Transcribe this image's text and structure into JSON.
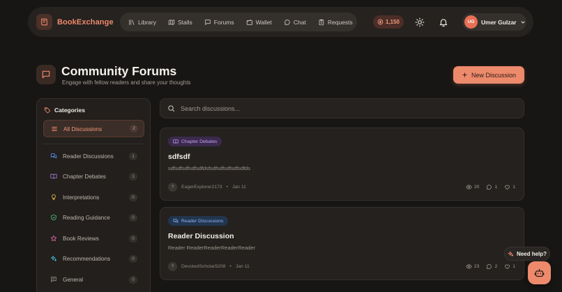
{
  "brand": {
    "name": "BookExchange"
  },
  "nav": {
    "items": [
      {
        "label": "Library",
        "icon": "library-icon"
      },
      {
        "label": "Stalls",
        "icon": "map-icon"
      },
      {
        "label": "Forums",
        "icon": "message-square-icon"
      },
      {
        "label": "Wallet",
        "icon": "wallet-icon"
      },
      {
        "label": "Chat",
        "icon": "chat-bubble-icon"
      },
      {
        "label": "Requests",
        "icon": "clipboard-icon"
      }
    ],
    "coins": "1,150",
    "user": {
      "initials": "UG",
      "name": "Umer Gulzar"
    }
  },
  "header": {
    "title": "Community Forums",
    "subtitle": "Engage with fellow readers and share your thoughts",
    "new_button": "New Discussion"
  },
  "categories": {
    "heading": "Categories",
    "active": {
      "label": "All Discussions",
      "count": "2"
    },
    "items": [
      {
        "label": "Reader Discussions",
        "count": "1",
        "icon": "chat-bubbles-icon",
        "color": "#5b8ee8"
      },
      {
        "label": "Chapter Debates",
        "count": "1",
        "icon": "book-open-icon",
        "color": "#a77be0"
      },
      {
        "label": "Interpretations",
        "count": "0",
        "icon": "lightbulb-icon",
        "color": "#e8b24a"
      },
      {
        "label": "Reading Guidance",
        "count": "0",
        "icon": "shield-check-icon",
        "color": "#4cc37a"
      },
      {
        "label": "Book Reviews",
        "count": "0",
        "icon": "star-icon",
        "color": "#e36aa8"
      },
      {
        "label": "Recommendations",
        "count": "0",
        "icon": "sparkles-icon",
        "color": "#42c3d6"
      },
      {
        "label": "General",
        "count": "0",
        "icon": "message-icon",
        "color": "#9a938b"
      }
    ]
  },
  "search": {
    "placeholder": "Search discussions..."
  },
  "posts": [
    {
      "tag": "Chapter Debates",
      "tag_color": "#a77be0",
      "title": "sdfsdf",
      "body": "sdfsdfsdfsdfsdfdsfsdfsdfsdfsdfsdfds",
      "avatar": "?",
      "author": "EagerExplorer2173",
      "date": "Jan 11",
      "views": "20",
      "comments": "1",
      "likes": "1"
    },
    {
      "tag": "Reader Discussions",
      "tag_color": "#5b8ee8",
      "title": "Reader Discussion",
      "body": "Reader ReaderReaderReaderReader",
      "avatar": "?",
      "author": "DevotedScholar5208",
      "date": "Jan 11",
      "views": "23",
      "comments": "2",
      "likes": "1"
    }
  ],
  "help": {
    "label": "Need help?"
  },
  "colors": {
    "accent": "#ed8a6c",
    "background": "#181614",
    "card": "#24211e"
  }
}
